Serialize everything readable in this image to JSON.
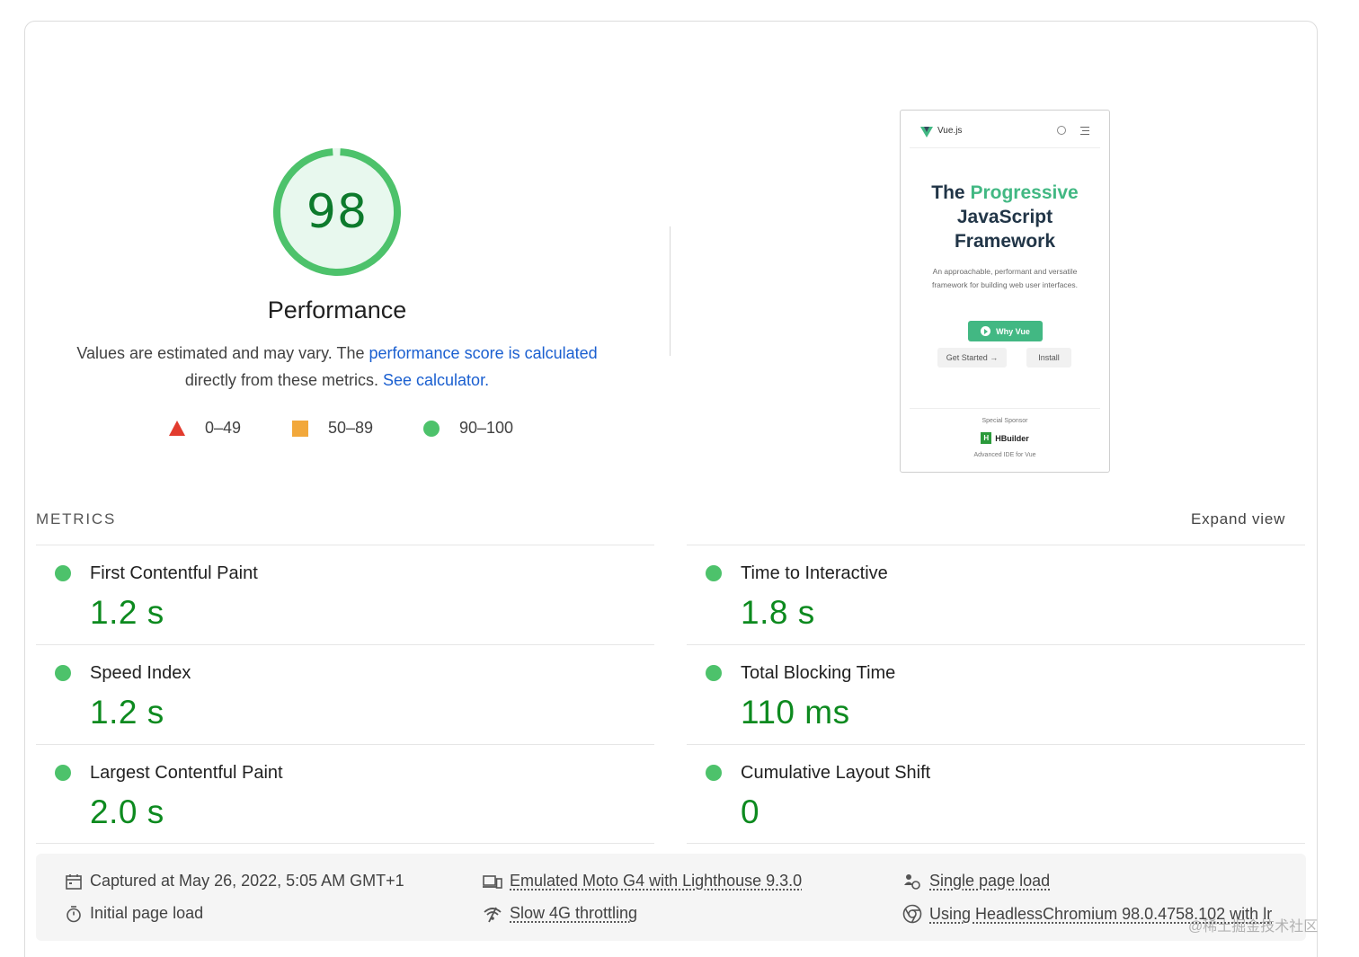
{
  "gauge": {
    "score": "98",
    "score_value": 98,
    "title": "Performance",
    "color": "#0cce6b"
  },
  "description": {
    "text_before": "Values are estimated and may vary. The ",
    "link1": "performance score is calculated",
    "text_middle": "directly from these metrics.",
    "link2": "See calculator."
  },
  "legend": [
    {
      "shape": "triangle",
      "label": "0–49",
      "color": "#ff4e42"
    },
    {
      "shape": "square",
      "label": "50–89",
      "color": "#ffa400"
    },
    {
      "shape": "circle",
      "label": "90–100",
      "color": "#0cce6b"
    }
  ],
  "thumbnail": {
    "brand": "Vue.js",
    "hero_w1": "The",
    "hero_w2": "Progressive",
    "hero_line2": "JavaScript",
    "hero_line3": "Framework",
    "subtitle": "An approachable, performant and versatile framework for building web user interfaces.",
    "why_button": "Why Vue",
    "get_started_button": "Get Started →",
    "install_button": "Install",
    "sponsor_label": "Special Sponsor",
    "sponsor_name": "HBuilder",
    "sponsor_logo_letter": "H",
    "sponsor_tagline": "Advanced IDE for Vue"
  },
  "metrics": {
    "title": "METRICS",
    "expand_label": "Expand view",
    "left": [
      {
        "label": "First Contentful Paint",
        "value": "1.2 s"
      },
      {
        "label": "Speed Index",
        "value": "1.2 s"
      },
      {
        "label": "Largest Contentful Paint",
        "value": "2.0 s"
      }
    ],
    "right": [
      {
        "label": "Time to Interactive",
        "value": "1.8 s"
      },
      {
        "label": "Total Blocking Time",
        "value": "110 ms"
      },
      {
        "label": "Cumulative Layout Shift",
        "value": "0"
      }
    ]
  },
  "footer": {
    "captured": "Captured at May 26, 2022, 5:05 AM GMT+1",
    "initial_load": "Initial page load",
    "emulated": "Emulated Moto G4 with Lighthouse 9.3.0",
    "throttling": "Slow 4G throttling",
    "single_load": "Single page load",
    "headless": "Using HeadlessChromium 98.0.4758.102 with lr"
  },
  "watermark": "@稀土掘金技术社区"
}
